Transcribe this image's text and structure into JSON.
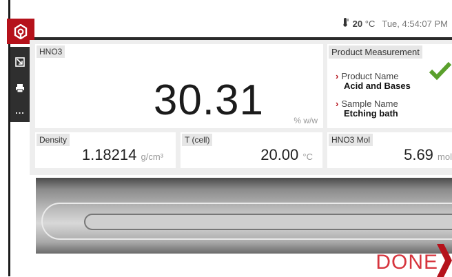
{
  "header": {
    "temperature": "20",
    "temperature_unit": "°C",
    "datetime": "Tue, 4:54:07 PM",
    "logo_icon": "gear-hex-logo-icon",
    "thermometer_icon": "thermometer-icon"
  },
  "sidebar": {
    "items": [
      {
        "icon": "export-icon"
      },
      {
        "icon": "print-icon"
      },
      {
        "icon": "more-icon",
        "label": "..."
      }
    ]
  },
  "main": {
    "label": "HNO3",
    "value": "30.31",
    "unit": "% w/w"
  },
  "product": {
    "label": "Product Measurement",
    "status_icon": "check-icon",
    "status_color": "#5aa02c",
    "product_name_label": "Product Name",
    "product_name_value": "Acid and Bases",
    "sample_name_label": "Sample Name",
    "sample_name_value": "Etching bath"
  },
  "density": {
    "label": "Density",
    "value": "1.18214",
    "unit": "g/cm³"
  },
  "tcell": {
    "label": "T (cell)",
    "value": "20.00",
    "unit": "°C"
  },
  "mol": {
    "label": "HNO3 Mol",
    "value": "5.69",
    "unit": "mol"
  },
  "done_label": "DONE",
  "accent_color": "#b5121b"
}
